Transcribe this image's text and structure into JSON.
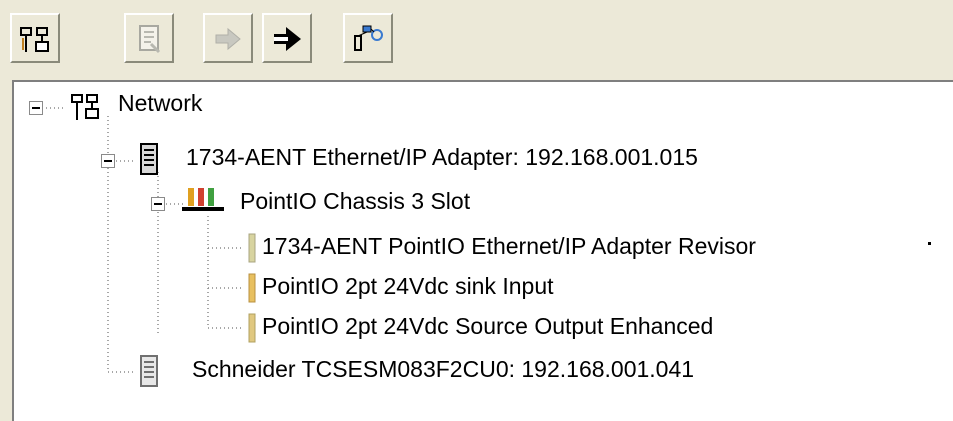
{
  "toolbar": {
    "buttons": [
      {
        "name": "network-view-button",
        "icon": "network-icon",
        "enabled": true
      },
      {
        "name": "properties-button",
        "icon": "document-icon",
        "enabled": false
      },
      {
        "name": "forward-button",
        "icon": "arrow-right-icon",
        "enabled": false
      },
      {
        "name": "next-button",
        "icon": "arrow-right-bold-icon",
        "enabled": true
      },
      {
        "name": "browse-button",
        "icon": "browse-network-icon",
        "enabled": true
      }
    ]
  },
  "tree": {
    "root": {
      "label": "Network",
      "icon": "network-icon",
      "expanded": true
    },
    "items": [
      {
        "label": "1734-AENT Ethernet/IP Adapter: 192.168.001.015",
        "icon": "device-icon",
        "expanded": true
      },
      {
        "label": "PointIO Chassis 3 Slot",
        "icon": "chassis-icon",
        "expanded": true
      },
      {
        "label": "1734-AENT PointIO Ethernet/IP Adapter Revisor",
        "icon": "module-icon"
      },
      {
        "label": "PointIO 2pt 24Vdc sink Input",
        "icon": "module-icon"
      },
      {
        "label": "PointIO 2pt 24Vdc Source Output Enhanced",
        "icon": "module-icon"
      },
      {
        "label": "Schneider TCSESM083F2CU0: 192.168.001.041",
        "icon": "device-icon"
      }
    ]
  }
}
